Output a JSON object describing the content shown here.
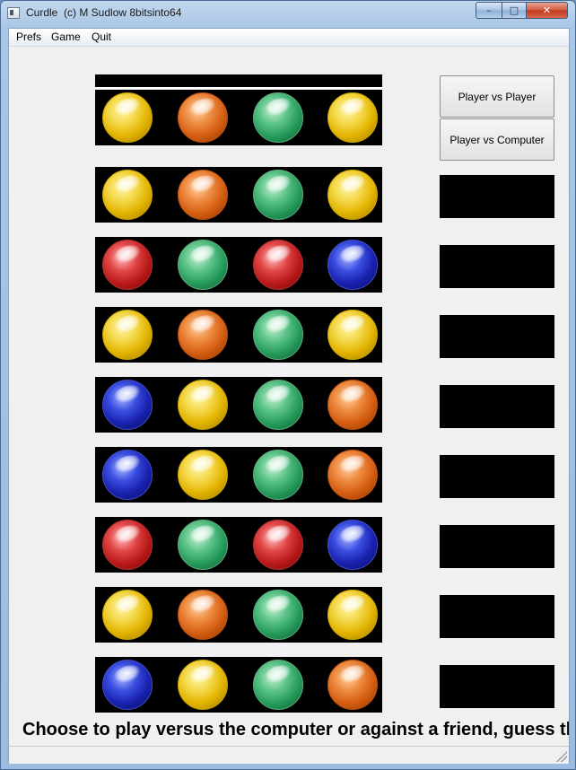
{
  "window": {
    "title": "Curdle  (c) M Sudlow 8bitsinto64",
    "controls": {
      "minimize": "–",
      "maximize": "□",
      "close": "✕"
    }
  },
  "menu": [
    "Prefs",
    "Game",
    "Quit"
  ],
  "buttons": {
    "player_vs_player": "Player vs Player",
    "player_vs_computer": "Player vs Computer"
  },
  "rows": [
    [
      "yellow",
      "orange",
      "green",
      "yellow"
    ],
    [
      "yellow",
      "orange",
      "green",
      "yellow"
    ],
    [
      "red",
      "green",
      "red",
      "blue"
    ],
    [
      "yellow",
      "orange",
      "green",
      "yellow"
    ],
    [
      "blue",
      "yellow",
      "green",
      "orange"
    ],
    [
      "blue",
      "yellow",
      "green",
      "orange"
    ],
    [
      "red",
      "green",
      "red",
      "blue"
    ],
    [
      "yellow",
      "orange",
      "green",
      "yellow"
    ],
    [
      "blue",
      "yellow",
      "green",
      "orange"
    ]
  ],
  "peg_boxes": 8,
  "colors": {
    "yellow": "#e2b400",
    "orange": "#d25c10",
    "green": "#249a5a",
    "red": "#b81818",
    "blue": "#1a22b0"
  },
  "instruction": "Choose to play versus the computer or against a friend, guess th"
}
